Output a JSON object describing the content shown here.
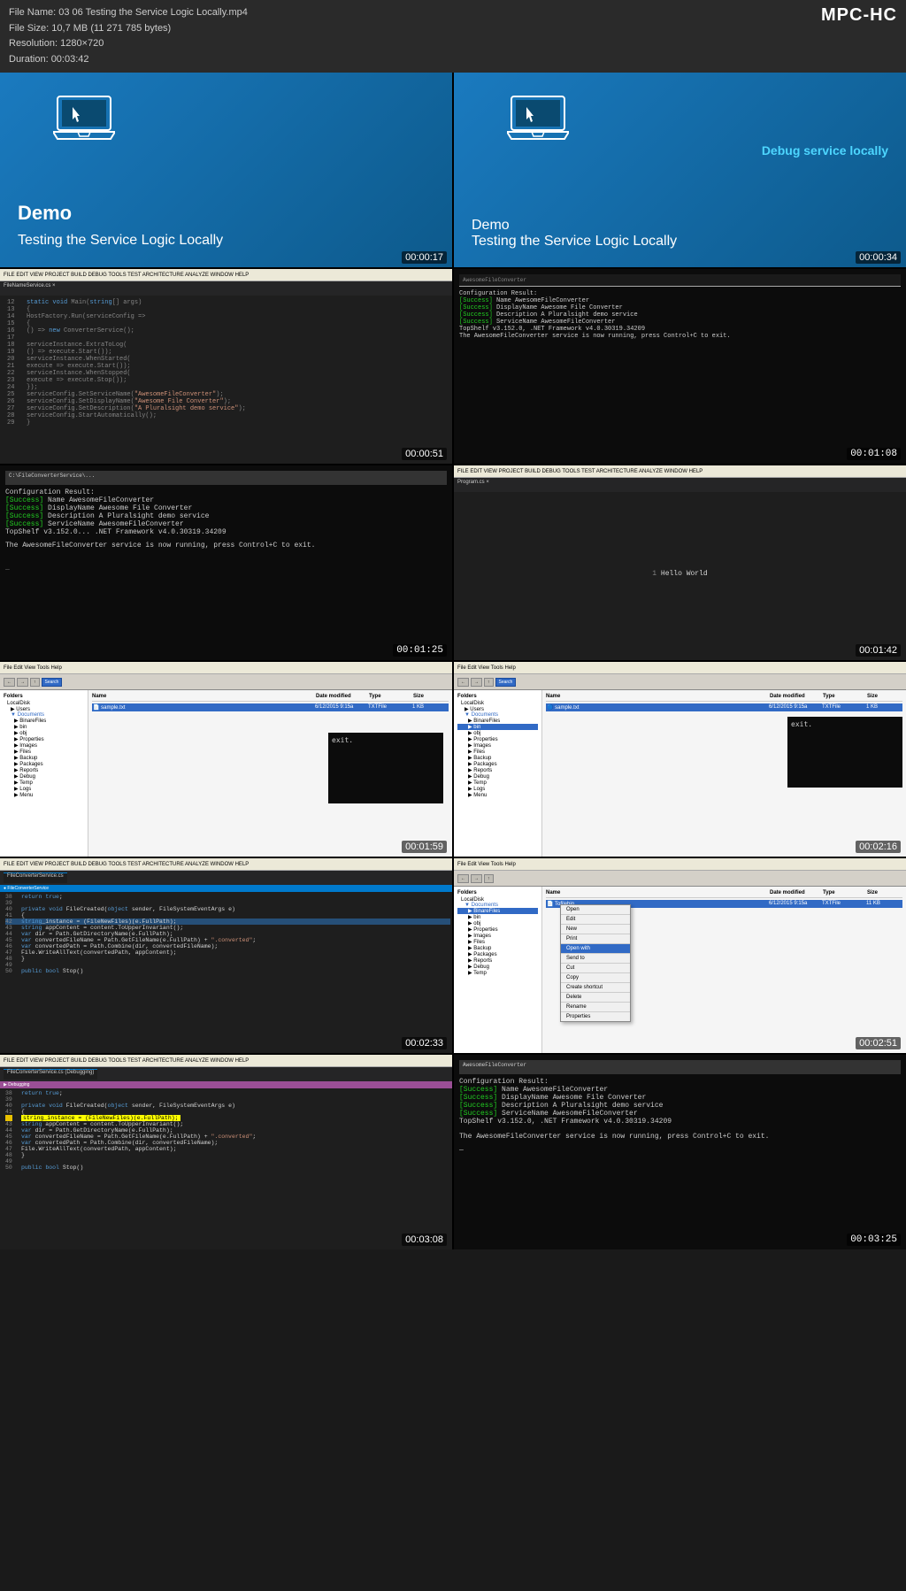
{
  "meta": {
    "filename": "File Name: 03 06 Testing the Service Logic Locally.mp4",
    "filesize": "File Size: 10,7 MB (11 271 785 bytes)",
    "resolution": "Resolution: 1280×720",
    "duration": "Duration: 00:03:42",
    "logo": "MPC-HC"
  },
  "slides": [
    {
      "id": "slide-1",
      "demo_label": "Demo",
      "title": "Testing the Service Logic Locally",
      "timestamp": "00:00:17",
      "type": "demo"
    },
    {
      "id": "slide-2",
      "demo_label": "Demo",
      "title": "Testing the Service Logic Locally",
      "subtitle": "Debug service locally",
      "timestamp": "00:00:34",
      "type": "demo-right"
    },
    {
      "id": "slide-3",
      "timestamp": "00:00:51",
      "type": "code"
    },
    {
      "id": "slide-4",
      "timestamp": "00:01:08",
      "type": "terminal"
    },
    {
      "id": "slide-5",
      "timestamp": "00:01:25",
      "type": "terminal2"
    },
    {
      "id": "slide-6",
      "timestamp": "00:01:42",
      "type": "code2"
    },
    {
      "id": "slide-7",
      "timestamp": "00:01:59",
      "type": "explorer"
    },
    {
      "id": "slide-8",
      "timestamp": "00:02:16",
      "type": "explorer2"
    },
    {
      "id": "slide-9",
      "timestamp": "00:02:33",
      "type": "code3"
    },
    {
      "id": "slide-10",
      "timestamp": "00:02:51",
      "type": "explorer3"
    },
    {
      "id": "slide-11",
      "timestamp": "00:03:08",
      "type": "code4"
    },
    {
      "id": "slide-12",
      "timestamp": "00:03:25",
      "type": "terminal3"
    }
  ],
  "terminal_output": [
    "Configuration Result:",
    "[Success] Name AwesomeFileConverter",
    "[Success] DisplayName Awesome File Converter",
    "[Success] Description A Pluralsight demo service",
    "[Success] ServiceName AwesomeFileConverter",
    "TopShelf v3.152.0, .NET Framework v4.0.30319.34209",
    "The AwesomeFileConverter service is now running, press Control+C to exit."
  ],
  "code_lines": [
    "static void Main(string[] args)",
    "{",
    "    HostFactory.Run(serviceConfig =>",
    "    {",
    "        () => new ConverterService();",
    "        serviceInstance.ExtraToLog(",
    "            () => execute.Start());",
    "        serviceInstance.WhenStarted(",
    "            execute => execute.Start());",
    "        serviceInstance.WhenStopped(",
    "            execute => execute.Stop());",
    "    });",
    "    serviceConfig.SetServiceName(\"AwesomeFileConverter\");",
    "    serviceConfig.SetDisplayName(\"Awesome File Converter\");",
    "    serviceConfig.SetDescription(\"A Pluralsight demo service\");",
    "    serviceConfig.StartAutomatically();",
    "}"
  ],
  "code_lines2": [
    "return true;",
    "",
    "private void FileCreated(object sender, FileSystemEventArgs e)",
    "{",
    "    string_instance = (FileNewFiles)(e.FullPath);",
    "    string appContent = content.ToUpperInvariant();",
    "    var dir = Path.GetDirectoryName(e.FullPath);",
    "    var convertedFileName = Path.GetFileName(e.FullPath) + \".converted\";",
    "    var convertedPath = Path.Combine(dir, convertedFileName);",
    "    File.WriteAllText(convertedPath, appContent);",
    "}",
    "",
    "public bool Stop()"
  ]
}
